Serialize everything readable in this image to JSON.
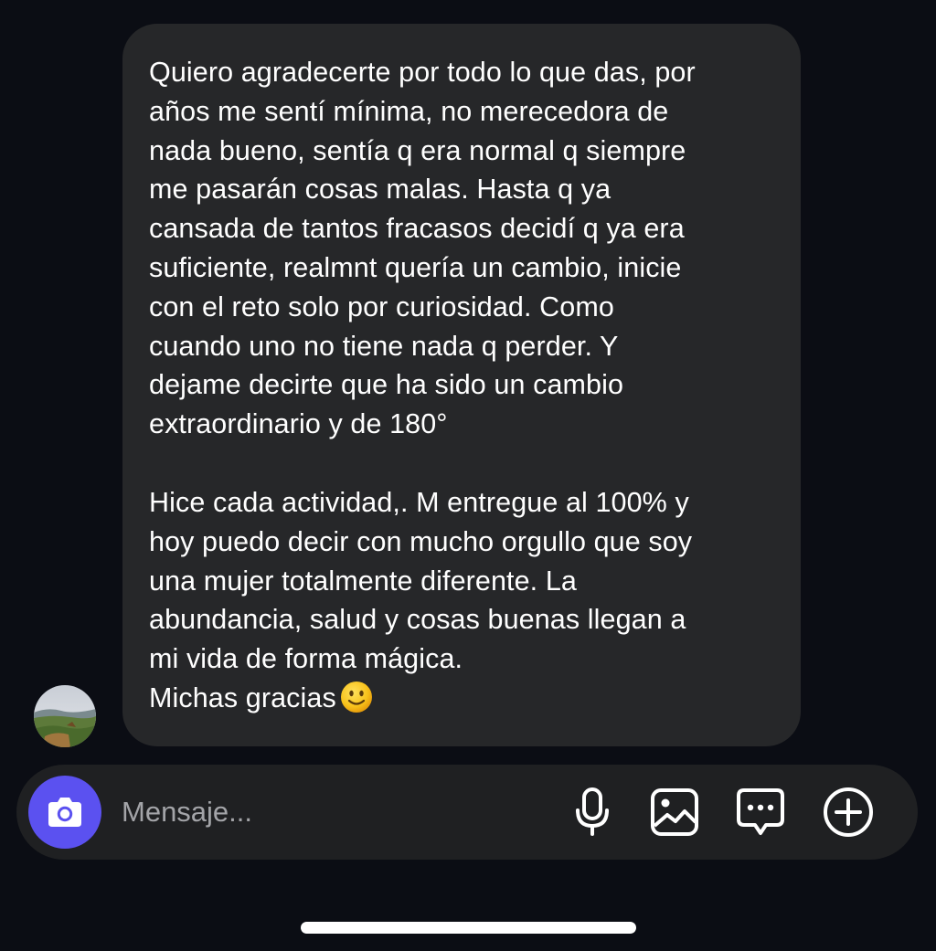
{
  "message": {
    "paragraph_1": [
      "Quiero agradecerte por todo lo que das, por",
      "años me sentí mínima, no merecedora de",
      "nada bueno, sentía q era normal q siempre",
      "me pasarán cosas malas. Hasta q ya",
      "cansada de tantos fracasos decidí q ya era",
      "suficiente, realmnt quería un cambio, inicie",
      "con el reto solo por curiosidad. Como",
      "cuando uno no tiene nada q perder. Y",
      "dejame decirte que ha sido un cambio",
      "extraordinario y de 180°"
    ],
    "paragraph_2": [
      "Hice cada actividad,. M entregue al 100% y",
      "hoy puedo decir con mucho orgullo que soy",
      "una mujer totalmente diferente. La",
      "abundancia, salud y cosas buenas llegan a",
      "mi vida de forma mágica."
    ],
    "closing_text": "Michas gracias",
    "closing_emoji": "slightly-smiling-face-emoji"
  },
  "composer": {
    "placeholder": "Mensaje...",
    "camera_icon": "camera-icon",
    "actions": [
      "microphone-icon",
      "image-icon",
      "sticker-chat-icon",
      "add-icon"
    ]
  },
  "colors": {
    "background": "#0b0d14",
    "bubble": "#262729",
    "composer": "#1f2022",
    "camera_button": "#5b51f0",
    "placeholder_text": "#a3a4a8"
  }
}
